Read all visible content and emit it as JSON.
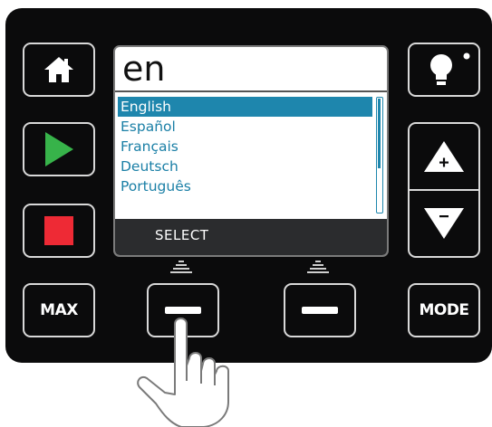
{
  "screen": {
    "title": "en",
    "languages": [
      "English",
      "Español",
      "Français",
      "Deutsch",
      "Português"
    ],
    "selected_index": 0,
    "softkey_left_label": "SELECT"
  },
  "buttons": {
    "max_label": "MAX",
    "mode_label": "MODE"
  },
  "colors": {
    "panel": "#0b0b0c",
    "highlight": "#1e86ad",
    "list_text": "#1a7fa6",
    "play_green": "#37b34a",
    "stop_red": "#ee2a35",
    "softkey_bar": "#2b2c2e"
  },
  "icons": {
    "home": "home-icon",
    "play": "play-icon",
    "stop": "stop-icon",
    "light": "lightbulb-icon",
    "up": "up-arrow-plus-icon",
    "down": "down-arrow-minus-icon",
    "softkey": "dash-icon",
    "hand": "pointing-hand-icon"
  }
}
